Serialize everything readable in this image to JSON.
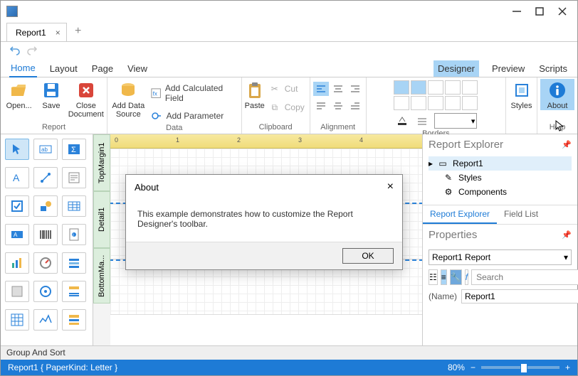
{
  "window": {
    "title": ""
  },
  "doc_tabs": [
    {
      "label": "Report1"
    }
  ],
  "ribbon_tabs_left": [
    "Home",
    "Layout",
    "Page",
    "View"
  ],
  "ribbon_tabs_right": [
    "Designer",
    "Preview",
    "Scripts"
  ],
  "ribbon_active_tab": "Home",
  "ribbon_right_highlight": "Designer",
  "ribbon_groups": {
    "report": {
      "label": "Report",
      "open": "Open...",
      "save": "Save",
      "close": "Close Document"
    },
    "data": {
      "label": "Data",
      "addsource": "Add Data Source",
      "calcfield": "Add Calculated Field",
      "param": "Add Parameter"
    },
    "clipboard": {
      "label": "Clipboard",
      "paste": "Paste",
      "cut": "Cut",
      "copy": "Copy"
    },
    "alignment": {
      "label": "Alignment"
    },
    "borders": {
      "label": "Borders"
    },
    "styles": {
      "label": "",
      "styles": "Styles"
    },
    "help": {
      "label": "Help",
      "about": "About"
    }
  },
  "bands": {
    "top": "TopMargin1",
    "detail": "Detail1",
    "bottom": "BottomMa..."
  },
  "ruler_marks": [
    "0",
    "1",
    "2",
    "3",
    "4"
  ],
  "explorer": {
    "title": "Report Explorer",
    "items": [
      {
        "label": "Report1",
        "icon": "doc",
        "selected": true,
        "indent": 0,
        "expander": true
      },
      {
        "label": "Styles",
        "icon": "pencil",
        "indent": 1
      },
      {
        "label": "Components",
        "icon": "gear",
        "indent": 1
      }
    ],
    "tabs": [
      "Report Explorer",
      "Field List"
    ],
    "active_tab": "Report Explorer"
  },
  "properties": {
    "title": "Properties",
    "object": "Report1  Report",
    "search_placeholder": "Search",
    "row": {
      "label": "(Name)",
      "value": "Report1"
    }
  },
  "group_sort": "Group And Sort",
  "status": {
    "left": "Report1 { PaperKind: Letter }",
    "zoom": "80%"
  },
  "dialog": {
    "title": "About",
    "body": "This example demonstrates how to customize the Report Designer's toolbar.",
    "ok": "OK"
  },
  "chart_data": null
}
